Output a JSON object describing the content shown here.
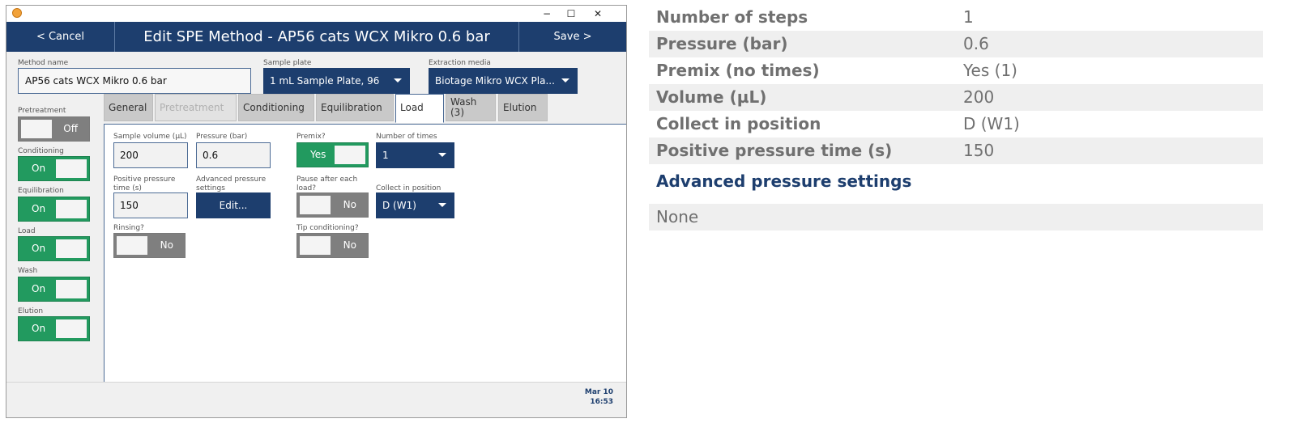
{
  "window": {
    "minimize": "−",
    "maximize": "☐",
    "close": "✕"
  },
  "header": {
    "cancel": "< Cancel",
    "title": "Edit SPE Method - AP56 cats WCX Mikro 0.6 bar",
    "save": "Save >"
  },
  "method": {
    "label": "Method name",
    "value": "AP56 cats WCX Mikro 0.6 bar"
  },
  "sample_plate": {
    "label": "Sample plate",
    "value": "1 mL Sample Plate, 96"
  },
  "extraction_media": {
    "label": "Extraction media",
    "value": "Biotage Mikro WCX Pla..."
  },
  "steps": [
    {
      "label": "Pretreatment",
      "state": "Off"
    },
    {
      "label": "Conditioning",
      "state": "On"
    },
    {
      "label": "Equilibration",
      "state": "On"
    },
    {
      "label": "Load",
      "state": "On"
    },
    {
      "label": "Wash",
      "state": "On"
    },
    {
      "label": "Elution",
      "state": "On"
    }
  ],
  "tabs": [
    "General",
    "Pretreatment",
    "Conditioning",
    "Equilibration",
    "Load",
    "Wash\n(3)",
    "Elution"
  ],
  "load": {
    "sample_volume_label": "Sample volume (µL)",
    "sample_volume": "200",
    "pressure_label": "Pressure (bar)",
    "pressure": "0.6",
    "premix_label": "Premix?",
    "premix": "Yes",
    "times_label": "Number of times",
    "times": "1",
    "ppt_label": "Positive pressure time (s)",
    "ppt": "150",
    "adv_label": "Advanced pressure settings",
    "adv_btn": "Edit...",
    "pause_label": "Pause after each load?",
    "pause": "No",
    "collect_label": "Collect in position",
    "collect": "D (W1)",
    "rinsing_label": "Rinsing?",
    "rinsing": "No",
    "tipcond_label": "Tip conditioning?",
    "tipcond": "No"
  },
  "footer": {
    "date": "Mar 10",
    "time": "16:53"
  },
  "summary": {
    "rows": [
      {
        "k": "Number of steps",
        "v": "1"
      },
      {
        "k": "Pressure (bar)",
        "v": "0.6"
      },
      {
        "k": "Premix (no times)",
        "v": "Yes (1)"
      },
      {
        "k": "Volume (µL)",
        "v": "200"
      },
      {
        "k": "Collect in position",
        "v": "D (W1)"
      },
      {
        "k": "Positive pressure time (s)",
        "v": "150"
      }
    ],
    "adv_title": "Advanced pressure settings",
    "adv_value": "None"
  },
  "colors": {
    "navy": "#1d3e6e",
    "green": "#229a5f",
    "gray": "#7f7f7f"
  }
}
